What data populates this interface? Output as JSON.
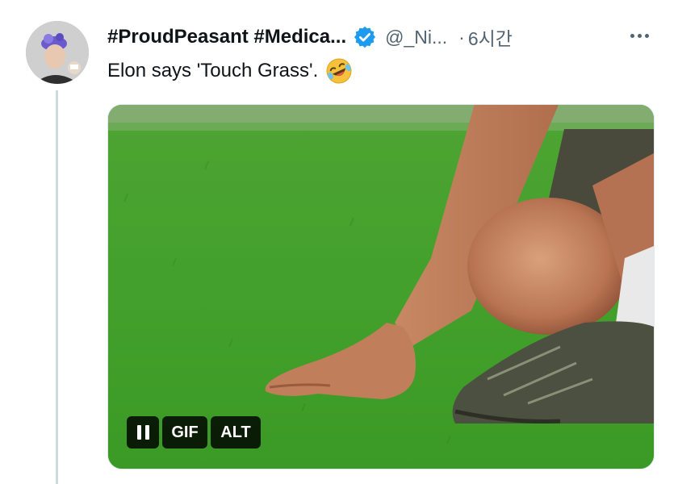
{
  "tweet": {
    "display_name": "#ProudPeasant #Medica...",
    "handle": "@_Ni...",
    "separator": "·",
    "timestamp": "6시간",
    "text": "Elon says 'Touch Grass'.",
    "emoji": "rolling-on-the-floor-laughing",
    "verified": true,
    "verified_color": "#1d9bf0",
    "avatar_icon": "avatar-photo",
    "more_icon": "more-dots-icon"
  },
  "media": {
    "type": "gif",
    "controls": {
      "pause_icon": "pause-icon",
      "gif_label": "GIF",
      "alt_label": "ALT"
    }
  },
  "colors": {
    "text_primary": "#0f1419",
    "text_secondary": "#536471",
    "thread_line": "#cfd9de"
  }
}
